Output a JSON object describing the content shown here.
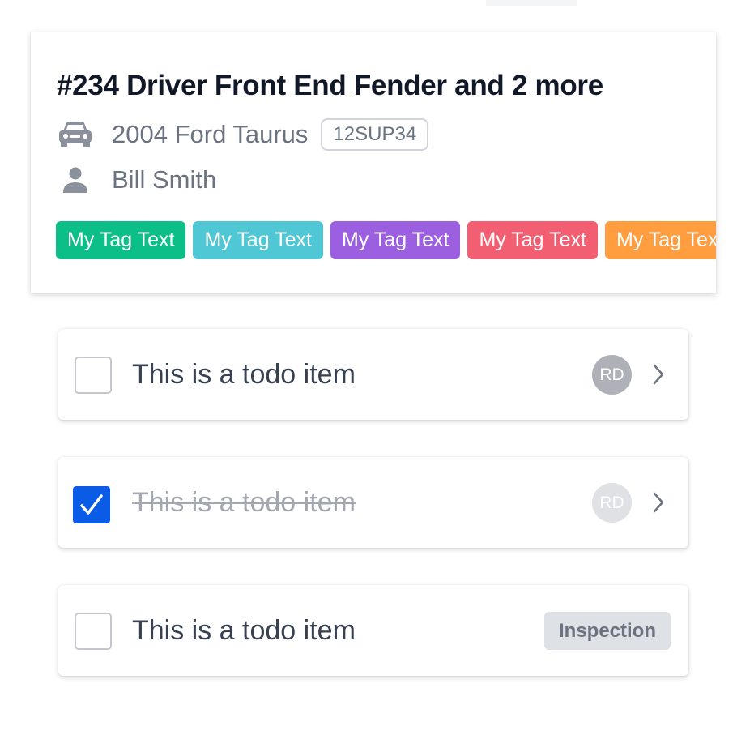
{
  "job": {
    "title": "#234 Driver Front End Fender and 2 more",
    "vehicle": "2004 Ford Taurus",
    "plate": "12SUP34",
    "customer": "Bill Smith",
    "vehicle_icon": "car-icon",
    "customer_icon": "person-icon"
  },
  "tags": [
    {
      "label": "My Tag Text",
      "color": "#0cbe87"
    },
    {
      "label": "My Tag Text",
      "color": "#4fc7d4"
    },
    {
      "label": "My Tag Text",
      "color": "#9b5fe0"
    },
    {
      "label": "My Tag Text",
      "color": "#f35f72"
    },
    {
      "label": "My Tag Text",
      "color": "#ff9d3f"
    }
  ],
  "todos": [
    {
      "text": "This is a todo item",
      "checked": false,
      "assignee": "RD"
    },
    {
      "text": "This is a todo item",
      "checked": true,
      "assignee": "RD"
    },
    {
      "text": "This is a todo item",
      "checked": false,
      "category": "Inspection"
    }
  ],
  "colors": {
    "checkbox_checked": "#0a5ce6",
    "title": "#111827",
    "muted_text": "#6b7280"
  }
}
